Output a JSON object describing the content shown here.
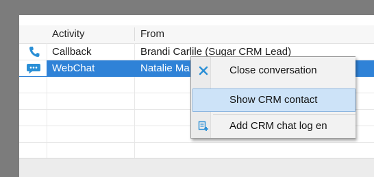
{
  "columns": {
    "activity": "Activity",
    "from": "From"
  },
  "rows": [
    {
      "icon": "phone-icon",
      "activity": "Callback",
      "from": "Brandi Carlile (Sugar CRM Lead)",
      "selected": false
    },
    {
      "icon": "chat-icon",
      "activity": "WebChat",
      "from": "Natalie Ma",
      "selected": true
    }
  ],
  "context_menu": {
    "items": [
      {
        "icon": "close-icon",
        "label": "Close conversation"
      },
      {
        "icon": "",
        "label": "Show CRM contact"
      },
      {
        "icon": "add-log-icon",
        "label": "Add CRM chat log en"
      }
    ]
  },
  "colors": {
    "selection": "#2f82d7",
    "menu_hover": "#cde3f8",
    "accent_icon": "#2a8fd6"
  }
}
